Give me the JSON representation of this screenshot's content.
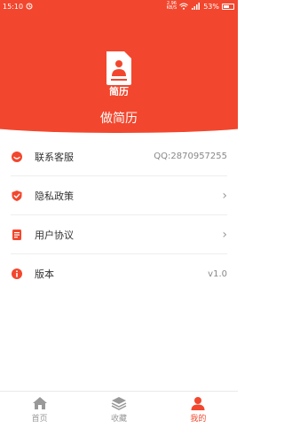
{
  "status": {
    "time": "15:10",
    "speed_value": "2.96",
    "speed_unit": "KB/S",
    "battery": "53%"
  },
  "app": {
    "logo_text": "简历",
    "name": "做简历"
  },
  "menu": [
    {
      "label": "联系客服",
      "value": "QQ:2870957255",
      "icon": "headset-icon"
    },
    {
      "label": "隐私政策",
      "value": "",
      "icon": "shield-check-icon"
    },
    {
      "label": "用户协议",
      "value": "",
      "icon": "document-icon"
    },
    {
      "label": "版本",
      "value": "v1.0",
      "icon": "info-icon"
    }
  ],
  "tabbar": {
    "items": [
      {
        "label": "首页",
        "icon": "home-icon"
      },
      {
        "label": "收藏",
        "icon": "layers-icon"
      },
      {
        "label": "我的",
        "icon": "user-icon"
      }
    ],
    "active": "我的"
  },
  "colors": {
    "accent": "#f2472e",
    "text": "#333333",
    "muted": "#999999"
  }
}
